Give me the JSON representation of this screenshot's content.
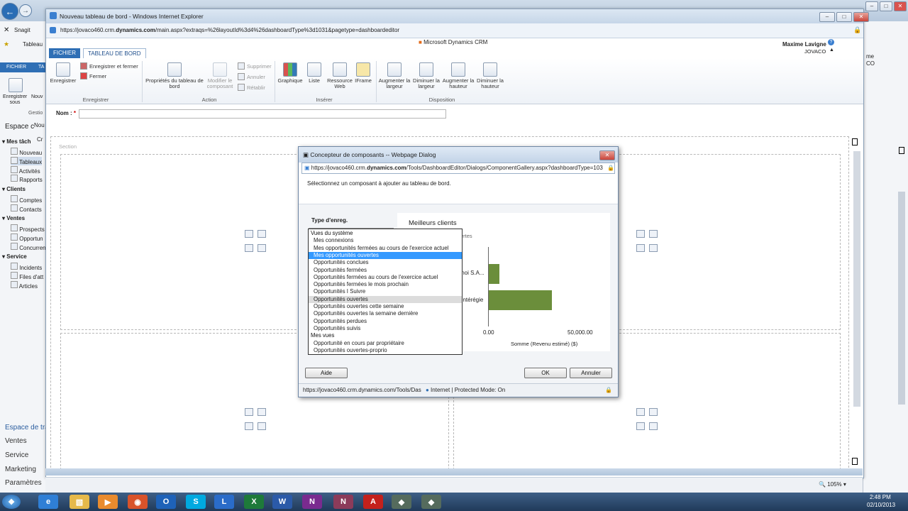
{
  "outer_browser": {
    "tabs_left": [
      "Snagit",
      "Tableau"
    ],
    "ribbon_tabs": [
      "FICHIER",
      "TA"
    ],
    "ribbon_buttons": [
      "Enregistrer sous",
      "Nouv"
    ],
    "group_label": "Gestio",
    "nav_header": "Espace c",
    "partial_labels": [
      "Nou",
      "Cr"
    ],
    "sidebar": {
      "sections": [
        {
          "title": "Mes tâch",
          "items": [
            "Nouveau",
            "Tableaux",
            "Activités",
            "Rapports"
          ]
        },
        {
          "title": "Clients",
          "items": [
            "Comptes",
            "Contacts"
          ]
        },
        {
          "title": "Ventes",
          "items": [
            "Prospects",
            "Opportun",
            "Concurren"
          ]
        },
        {
          "title": "Service",
          "items": [
            "Incidents",
            "Files d'att",
            "Articles"
          ]
        }
      ],
      "bottom_links": [
        "Espace de tra",
        "Ventes",
        "Service",
        "Marketing",
        "Paramètres"
      ]
    },
    "right_user_partial": [
      "me",
      "CO"
    ],
    "zoom": "105%",
    "clock_time": "2:48 PM",
    "clock_date": "02/10/2013"
  },
  "ie_window": {
    "title": "Nouveau tableau de bord - Windows Internet Explorer",
    "url_prefix": "https://jovaco460.crm.",
    "url_bold": "dynamics.com",
    "url_suffix": "/main.aspx?extraqs=%26layoutId%3d4%26dashboardType%3d1031&pagetype=dashboardeditor",
    "app_title": "Microsoft Dynamics CRM",
    "user_name": "Maxime Lavigne",
    "org_name": "JOVACO",
    "tabs": [
      "FICHIER",
      "TABLEAU DE BORD"
    ],
    "ribbon": {
      "save": "Enregistrer",
      "save_close": "Enregistrer et fermer",
      "close": "Fermer",
      "group_save": "Enregistrer",
      "props": "Propriétés du tableau de bord",
      "edit": "Modifier le composant",
      "delete": "Supprimer",
      "undo": "Annuler",
      "redo": "Rétablir",
      "group_action": "Action",
      "chart": "Graphique",
      "list": "Liste",
      "web": "Ressource Web",
      "iframe": "IFrame",
      "group_insert": "Insérer",
      "inc_width": "Augmenter la largeur",
      "dec_width": "Diminuer la largeur",
      "inc_height": "Augmenter la hauteur",
      "dec_height": "Diminuer la hauteur",
      "group_layout": "Disposition"
    },
    "name_label": "Nom :",
    "name_required": "*",
    "section_label": "Section"
  },
  "dialog": {
    "title": "Concepteur de composants -- Webpage Dialog",
    "url_prefix": "https://jovaco460.crm.",
    "url_bold": "dynamics.com",
    "url_suffix": "/Tools/DashboardEditor/Dialogs/ComponentGallery.aspx?dashboardType=103",
    "instruction": "Sélectionnez un composant à ajouter au tableau de bord.",
    "record_type_label": "Type d'enreg.",
    "list": [
      {
        "text": "Vues du système",
        "kind": "group"
      },
      {
        "text": "Mes connexions",
        "kind": "item"
      },
      {
        "text": "Mes opportunités fermées au cours de l'exercice actuel",
        "kind": "item"
      },
      {
        "text": "Mes opportunités ouvertes",
        "kind": "selected"
      },
      {
        "text": "Opportunités conclues",
        "kind": "item"
      },
      {
        "text": "Opportunités fermées",
        "kind": "item"
      },
      {
        "text": "Opportunités fermées au cours de l'exercice actuel",
        "kind": "item"
      },
      {
        "text": "Opportunités fermées le mois prochain",
        "kind": "item"
      },
      {
        "text": "Opportunités I Suivre",
        "kind": "item"
      },
      {
        "text": "Opportunités ouvertes",
        "kind": "hover"
      },
      {
        "text": "Opportunités ouvertes cette semaine",
        "kind": "item"
      },
      {
        "text": "Opportunités ouvertes la semaine dernière",
        "kind": "item"
      },
      {
        "text": "Opportunités perdues",
        "kind": "item"
      },
      {
        "text": "Opportunités suivis",
        "kind": "item"
      },
      {
        "text": "Mes vues",
        "kind": "group"
      },
      {
        "text": "Opportunité en cours par propriétaire",
        "kind": "item"
      },
      {
        "text": "Opportunités ouvertes-proprio",
        "kind": "item"
      }
    ],
    "help_button": "Aide",
    "ok_button": "OK",
    "cancel_button": "Annuler",
    "status_url": "https://jovaco460.crm.dynamics.com/Tools/Das",
    "status_zone": "Internet | Protected Mode: On"
  },
  "chart_data": {
    "type": "bar",
    "title": "Meilleurs clients",
    "subtitle_partial": "ertes",
    "categories": [
      "moi S.A...",
      "ontérégie"
    ],
    "values": [
      6000,
      35000
    ],
    "xlim": [
      0,
      60000
    ],
    "tick_labels": [
      "0.00",
      "50,000.00"
    ],
    "xlabel": "Somme (Revenu estimé) ($)",
    "bar_color": "#6b8e3b",
    "orientation": "horizontal"
  }
}
